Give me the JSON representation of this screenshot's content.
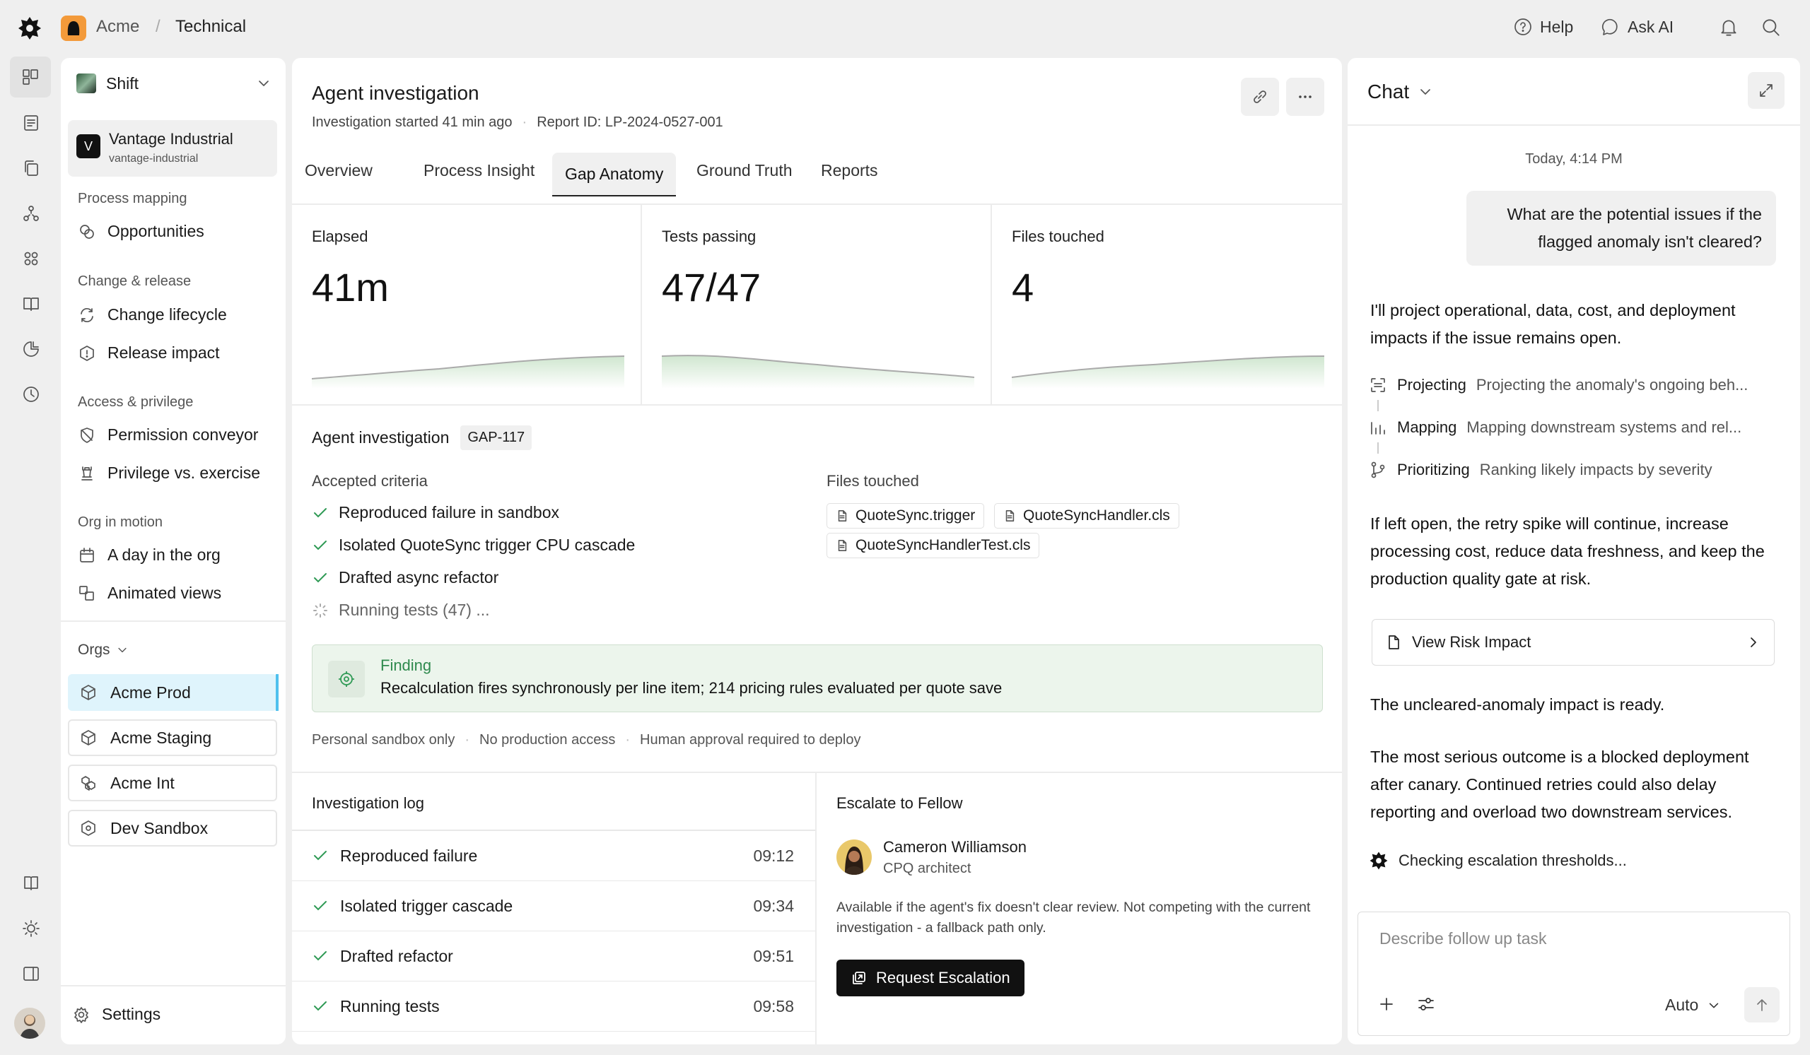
{
  "topbar": {
    "org": "Acme",
    "separator": "/",
    "section": "Technical",
    "help": "Help",
    "ask_ai": "Ask AI"
  },
  "sidebar": {
    "workspace": "Shift",
    "account": {
      "initial": "V",
      "name": "Vantage Industrial",
      "slug": "vantage-industrial"
    },
    "sections": [
      {
        "title": "Process mapping",
        "items": [
          "Opportunities"
        ]
      },
      {
        "title": "Change & release",
        "items": [
          "Change lifecycle",
          "Release impact"
        ]
      },
      {
        "title": "Access & privilege",
        "items": [
          "Permission conveyor",
          "Privilege vs. exercise"
        ]
      },
      {
        "title": "Org in motion",
        "items": [
          "A day in the org",
          "Animated views"
        ]
      }
    ],
    "orgs_label": "Orgs",
    "orgs": [
      "Acme Prod",
      "Acme Staging",
      "Acme Int",
      "Dev Sandbox"
    ],
    "settings": "Settings"
  },
  "main": {
    "title": "Agent investigation",
    "started": "Investigation started 41 min ago",
    "report_id": "Report ID: LP-2024-0527-001",
    "tabs": [
      "Overview",
      "Process Insight",
      "Gap Anatomy",
      "Ground Truth",
      "Reports"
    ],
    "stats": [
      {
        "label": "Elapsed",
        "value": "41m"
      },
      {
        "label": "Tests passing",
        "value": "47/47"
      },
      {
        "label": "Files touched",
        "value": "4"
      }
    ],
    "investigation": {
      "title": "Agent investigation",
      "gap": "GAP-117",
      "criteria_label": "Accepted criteria",
      "criteria": [
        "Reproduced failure in sandbox",
        "Isolated QuoteSync trigger CPU cascade",
        "Drafted async refactor"
      ],
      "running": "Running tests (47) ...",
      "files_label": "Files touched",
      "files": [
        "QuoteSync.trigger",
        "QuoteSyncHandler.cls",
        "QuoteSyncHandlerTest.cls"
      ],
      "finding_label": "Finding",
      "finding_text": "Recalculation fires synchronously per line item; 214 pricing rules evaluated per quote save",
      "constraints": [
        "Personal sandbox only",
        "No production access",
        "Human approval required to deploy"
      ]
    },
    "log": {
      "title": "Investigation log",
      "rows": [
        {
          "label": "Reproduced failure",
          "time": "09:12"
        },
        {
          "label": "Isolated trigger cascade",
          "time": "09:34"
        },
        {
          "label": "Drafted refactor",
          "time": "09:51"
        },
        {
          "label": "Running tests",
          "time": "09:58"
        }
      ]
    },
    "escalate": {
      "title": "Escalate to Fellow",
      "name": "Cameron Williamson",
      "role": "CPQ architect",
      "description": "Available if the agent's fix doesn't clear review. Not competing with the current investigation - a fallback path only.",
      "button": "Request Escalation"
    }
  },
  "chat": {
    "title": "Chat",
    "timestamp": "Today, 4:14 PM",
    "user_message": "What are the potential issues if the flagged anomaly isn't cleared?",
    "intro": "I'll project operational, data, cost, and deployment impacts if the issue remains open.",
    "steps": [
      {
        "label": "Projecting",
        "detail": "Projecting the anomaly's ongoing beh..."
      },
      {
        "label": "Mapping",
        "detail": "Mapping downstream systems and rel..."
      },
      {
        "label": "Prioritizing",
        "detail": "Ranking likely impacts by severity"
      }
    ],
    "summary": "If left open, the retry spike will continue, increase processing cost, reduce data freshness, and keep the production quality gate at risk.",
    "card": "View Risk Impact",
    "ready": "The uncleared-anomaly impact is ready.",
    "outcome": "The most serious outcome is a blocked deployment after canary. Continued retries could also delay reporting and overload two downstream services.",
    "checking": "Checking escalation thresholds...",
    "input_placeholder": "Describe follow up task",
    "mode": "Auto"
  }
}
